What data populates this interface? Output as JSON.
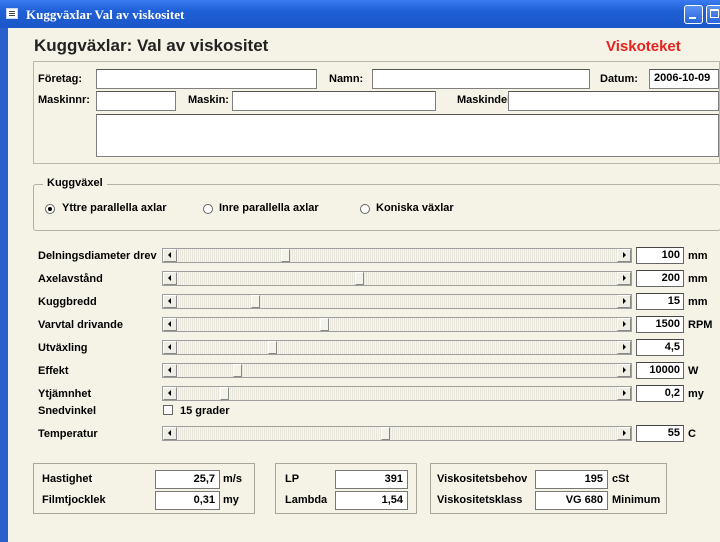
{
  "window": {
    "title": "Kuggväxlar Val av viskositet"
  },
  "header": {
    "heading": "Kuggväxlar: Val av viskositet",
    "brand": "Viskoteket"
  },
  "info": {
    "foretag_label": "Företag:",
    "foretag_value": "",
    "namn_label": "Namn:",
    "namn_value": "",
    "datum_label": "Datum:",
    "datum_value": "2006-10-09",
    "maskinnr_label": "Maskinnr:",
    "maskinnr_value": "",
    "maskin_label": "Maskin:",
    "maskin_value": "",
    "maskindel_label": "Maskindel:",
    "maskindel_value": "",
    "notes_value": ""
  },
  "kuggvaxel": {
    "legend": "Kuggväxel",
    "options": [
      {
        "label": "Yttre parallella axlar",
        "selected": true
      },
      {
        "label": "Inre parallella axlar",
        "selected": false
      },
      {
        "label": "Koniska växlar",
        "selected": false
      }
    ]
  },
  "params": [
    {
      "label": "Delningsdiameter drev",
      "value": "100",
      "unit": "mm",
      "level": 0.24
    },
    {
      "label": "Axelavstånd",
      "value": "200",
      "unit": "mm",
      "level": 0.41
    },
    {
      "label": "Kuggbredd",
      "value": "15",
      "unit": "mm",
      "level": 0.17
    },
    {
      "label": "Varvtal drivande",
      "value": "1500",
      "unit": "RPM",
      "level": 0.33
    },
    {
      "label": "Utväxling",
      "value": "4,5",
      "unit": "",
      "level": 0.21
    },
    {
      "label": "Effekt",
      "value": "10000",
      "unit": "W",
      "level": 0.13
    },
    {
      "label": "Ytjämnhet",
      "value": "0,2",
      "unit": "my",
      "level": 0.1
    }
  ],
  "snedvinkel": {
    "label": "Snedvinkel",
    "checkbox_label": "15 grader",
    "checked": false
  },
  "temperatur": {
    "label": "Temperatur",
    "value": "55",
    "unit": "C",
    "level": 0.47
  },
  "results": {
    "hastighet_label": "Hastighet",
    "hastighet_value": "25,7",
    "hastighet_unit": "m/s",
    "filmtjocklek_label": "Filmtjocklek",
    "filmtjocklek_value": "0,31",
    "filmtjocklek_unit": "my",
    "lp_label": "LP",
    "lp_value": "391",
    "lambda_label": "Lambda",
    "lambda_value": "1,54",
    "viskbehov_label": "Viskositetsbehov",
    "viskbehov_value": "195",
    "viskbehov_unit": "cSt",
    "viskklass_label": "Viskositetsklass",
    "viskklass_value": "VG 680",
    "viskklass_unit": "Minimum"
  }
}
